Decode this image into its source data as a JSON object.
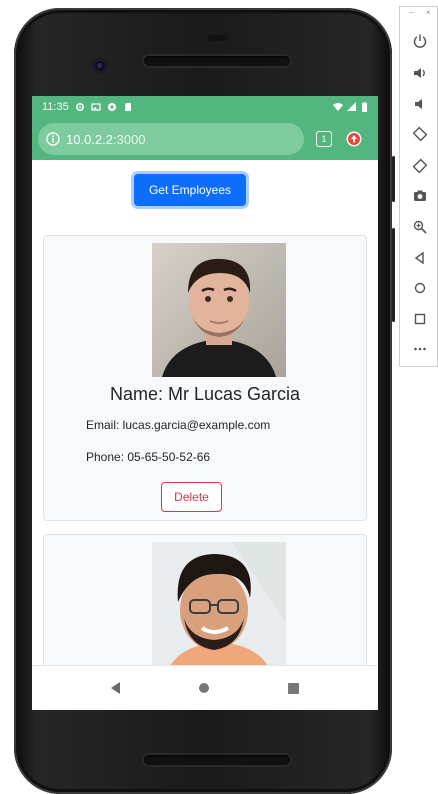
{
  "status_bar": {
    "time": "11:35"
  },
  "browser": {
    "url_host": "10.0.2.2",
    "url_port": ":3000",
    "tab_count": "1"
  },
  "page": {
    "get_button_label": "Get Employees"
  },
  "employees": [
    {
      "name": "Name: Mr Lucas Garcia",
      "email": "Email: lucas.garcia@example.com",
      "phone": "Phone: 05-65-50-52-66",
      "delete_label": "Delete"
    }
  ],
  "colors": {
    "status_bar": "#53b67e",
    "url_pill": "#7dcb9e",
    "primary": "#0d6efd",
    "danger": "#dc3545",
    "card_bg": "#f8f9fa"
  },
  "emulator_toolbar": {
    "window_min": "–",
    "window_close": "×",
    "icons": [
      "power-icon",
      "volume-up-icon",
      "volume-down-icon",
      "rotate-left-icon",
      "rotate-right-icon",
      "camera-icon",
      "zoom-icon",
      "back-icon",
      "home-icon",
      "overview-icon",
      "more-icon"
    ]
  }
}
